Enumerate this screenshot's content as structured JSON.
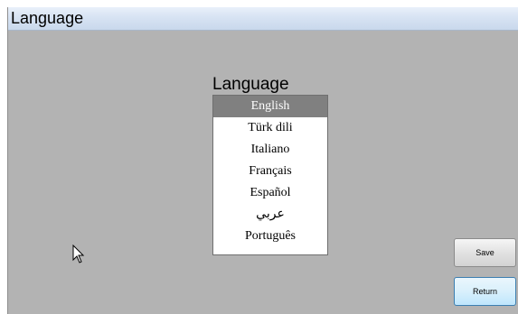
{
  "window": {
    "title": "Language"
  },
  "panel": {
    "heading": "Language",
    "languages": [
      {
        "label": "English",
        "selected": true
      },
      {
        "label": "Türk dili",
        "selected": false
      },
      {
        "label": "Italiano",
        "selected": false
      },
      {
        "label": "Français",
        "selected": false
      },
      {
        "label": "Español",
        "selected": false
      },
      {
        "label": "عربي",
        "selected": false
      },
      {
        "label": "Português",
        "selected": false
      }
    ]
  },
  "buttons": {
    "save_label": "Save",
    "return_label": "Return"
  },
  "colors": {
    "titlebar": "#d7e3f3",
    "background": "#b3b3b3",
    "selected": "#808080"
  }
}
